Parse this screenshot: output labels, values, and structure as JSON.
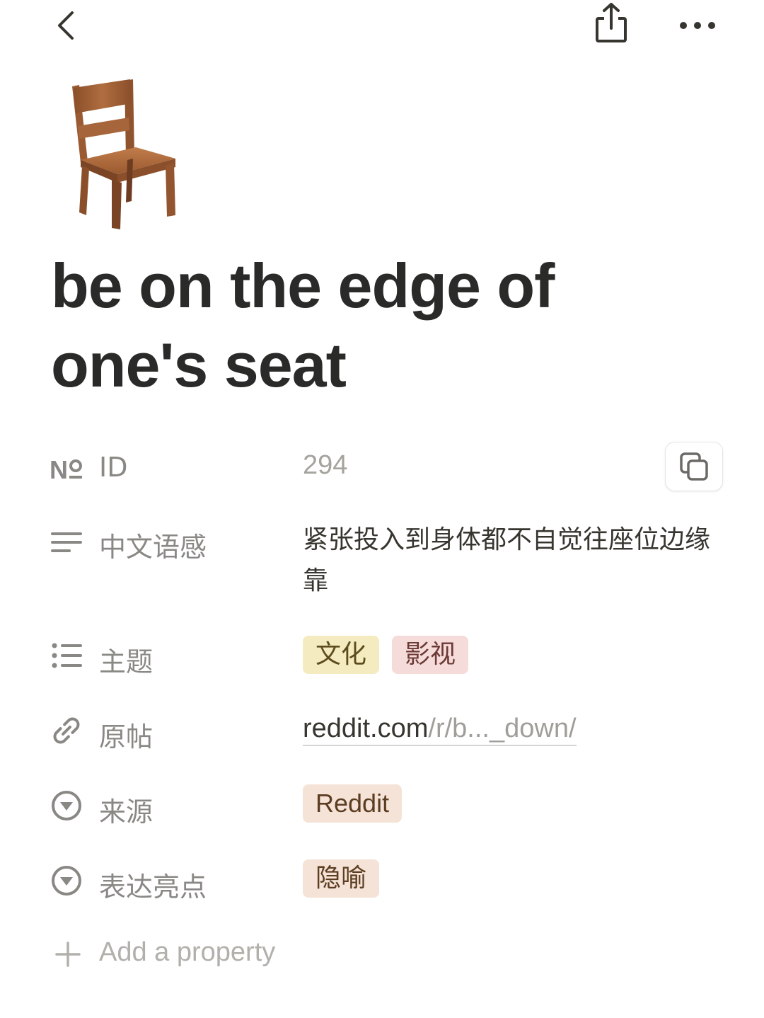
{
  "header": {
    "back_icon": "chevron-left-icon",
    "share_icon": "share-icon",
    "more_icon": "more-horizontal-icon"
  },
  "page": {
    "icon": "chair-emoji",
    "title_line1": "be on the edge of",
    "title_line2": "one's seat"
  },
  "properties": {
    "id": {
      "icon": "number-icon",
      "label": "ID",
      "value": "294"
    },
    "chinese_sense": {
      "icon": "text-lines-icon",
      "label": "中文语感",
      "value": "紧张投入到身体都不自觉往座位边缘靠"
    },
    "topic": {
      "icon": "multi-select-icon",
      "label": "主题",
      "tags": [
        {
          "label": "文化",
          "bg": "#f4ecc0",
          "color": "#5d4c1f"
        },
        {
          "label": "影视",
          "bg": "#f5dcdb",
          "color": "#6b3a35"
        }
      ]
    },
    "source_post": {
      "icon": "link-icon",
      "label": "原帖",
      "link_main": "reddit.com",
      "link_rest": "/r/b..._down/"
    },
    "source": {
      "icon": "select-icon",
      "label": "来源",
      "tag": {
        "label": "Reddit",
        "bg": "#f4e3d6",
        "color": "#5c3d22"
      }
    },
    "highlight": {
      "icon": "select-icon",
      "label": "表达亮点",
      "tag": {
        "label": "隐喻",
        "bg": "#f4e3d6",
        "color": "#5c3d22"
      }
    }
  },
  "add_property": {
    "icon": "plus-icon",
    "label": "Add a property"
  }
}
